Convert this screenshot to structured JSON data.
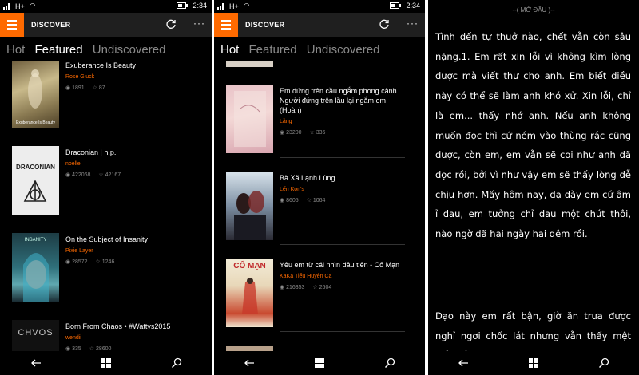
{
  "status": {
    "network": "H+",
    "time": "2:34"
  },
  "app": {
    "title": "DISCOVER",
    "more": "···"
  },
  "tabs": [
    "Hot",
    "Featured",
    "Undiscovered"
  ],
  "screen1_books": [
    {
      "title": "Exuberance Is Beauty",
      "author": "Rose Gluck",
      "reads": "1891",
      "votes": "87",
      "cover_text": "Exuberance Is Beauty"
    },
    {
      "title": "Draconian | h.p.",
      "author": "noelle",
      "reads": "422068",
      "votes": "42167",
      "cover_text": "DRACONIAN"
    },
    {
      "title": "On the Subject of Insanity",
      "author": "Pixie Layer",
      "reads": "28572",
      "votes": "1246",
      "cover_text": "INSANITY"
    },
    {
      "title": "Born From Chaos • #Wattys2015",
      "author": "wendii",
      "reads": "335",
      "votes": "28600",
      "cover_text": "CHVOS"
    }
  ],
  "screen2_books": [
    {
      "title": "Em đứng trên cầu ngắm phong cảnh. Người đứng trên lầu lại ngắm em (Hoàn)",
      "author": "Lăng",
      "reads": "23200",
      "votes": "336",
      "cover_text": ""
    },
    {
      "title": "Bà Xã Lạnh Lùng",
      "author": "Lến Kon's",
      "reads": "8605",
      "votes": "1064",
      "cover_text": ""
    },
    {
      "title": "Yêu em từ cái nhìn đầu tiên - Cố Mạn",
      "author": "KaKa Tiểu Huyên Ca",
      "reads": "216353",
      "votes": "2604",
      "cover_text": "CỐ MẠN"
    }
  ],
  "reader": {
    "header": "--( MỞ ĐẦU )--",
    "paragraph1": "Tình đến tự thuở nào, chết vẫn còn sâu nặng.1.   Em rất xin lỗi vì không kìm lòng được mà viết thư cho anh. Em biết điều này có thể sẽ làm anh khó xử. Xin lỗi, chỉ là em... thấy nhớ anh. Nếu anh không muốn đọc thì cứ ném vào thùng rác cũng được, còn em, em vẫn sẽ coi như anh đã đọc rồi, bởi vì như vậy em sẽ thấy lòng dễ chịu hơn. Mấy hôm nay, dạ dày em cứ âm ỉ đau, em tưởng chỉ đau một chút thôi, nào ngờ đã hai ngày hai đêm rồi.",
    "paragraph2": "Dạo này em rất bận, giờ ăn trưa được nghỉ ngơi chốc lát nhưng vẫn thấy mệt mỏi đến"
  },
  "colors": {
    "accent": "#ff6a00",
    "background": "#000000",
    "topbar": "#1f1f1f"
  }
}
